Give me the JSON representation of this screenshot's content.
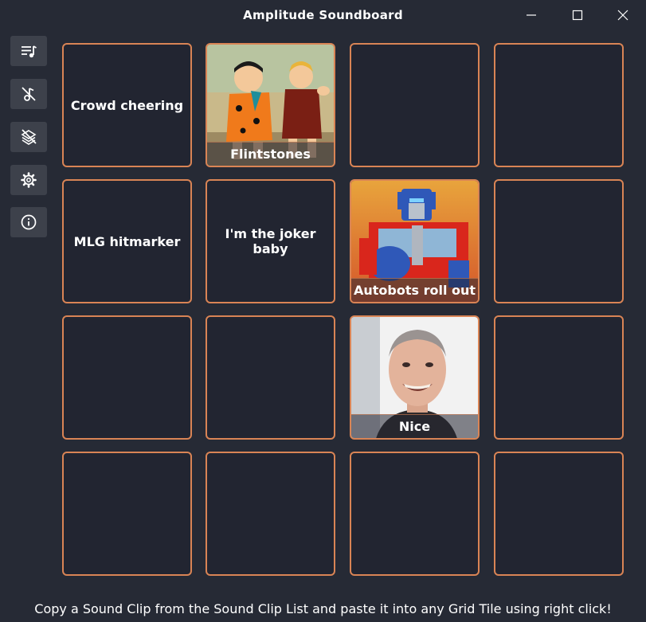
{
  "window": {
    "title": "Amplitude Soundboard"
  },
  "sidebar": {
    "items": [
      {
        "icon": "playlist-icon"
      },
      {
        "icon": "music-off-icon"
      },
      {
        "icon": "layers-off-icon"
      },
      {
        "icon": "gear-icon"
      },
      {
        "icon": "info-icon"
      }
    ]
  },
  "grid": {
    "tiles": [
      {
        "label": "Crowd cheering"
      },
      {
        "label": "Flintstones",
        "image": "flintstones-image"
      },
      {
        "label": ""
      },
      {
        "label": ""
      },
      {
        "label": "MLG hitmarker"
      },
      {
        "label": "I'm the joker baby"
      },
      {
        "label": "Autobots roll out",
        "image": "optimus-prime-image"
      },
      {
        "label": ""
      },
      {
        "label": ""
      },
      {
        "label": ""
      },
      {
        "label": "Nice",
        "image": "michael-rosen-image"
      },
      {
        "label": ""
      },
      {
        "label": ""
      },
      {
        "label": ""
      },
      {
        "label": ""
      },
      {
        "label": ""
      }
    ]
  },
  "footer": {
    "hint": "Copy a Sound Clip from the Sound Clip List and paste it into any Grid Tile using right click!"
  },
  "colors": {
    "background": "#262a35",
    "tile_bg": "#222531",
    "tile_border": "#d98455",
    "sidebar_button": "#3d414b"
  }
}
